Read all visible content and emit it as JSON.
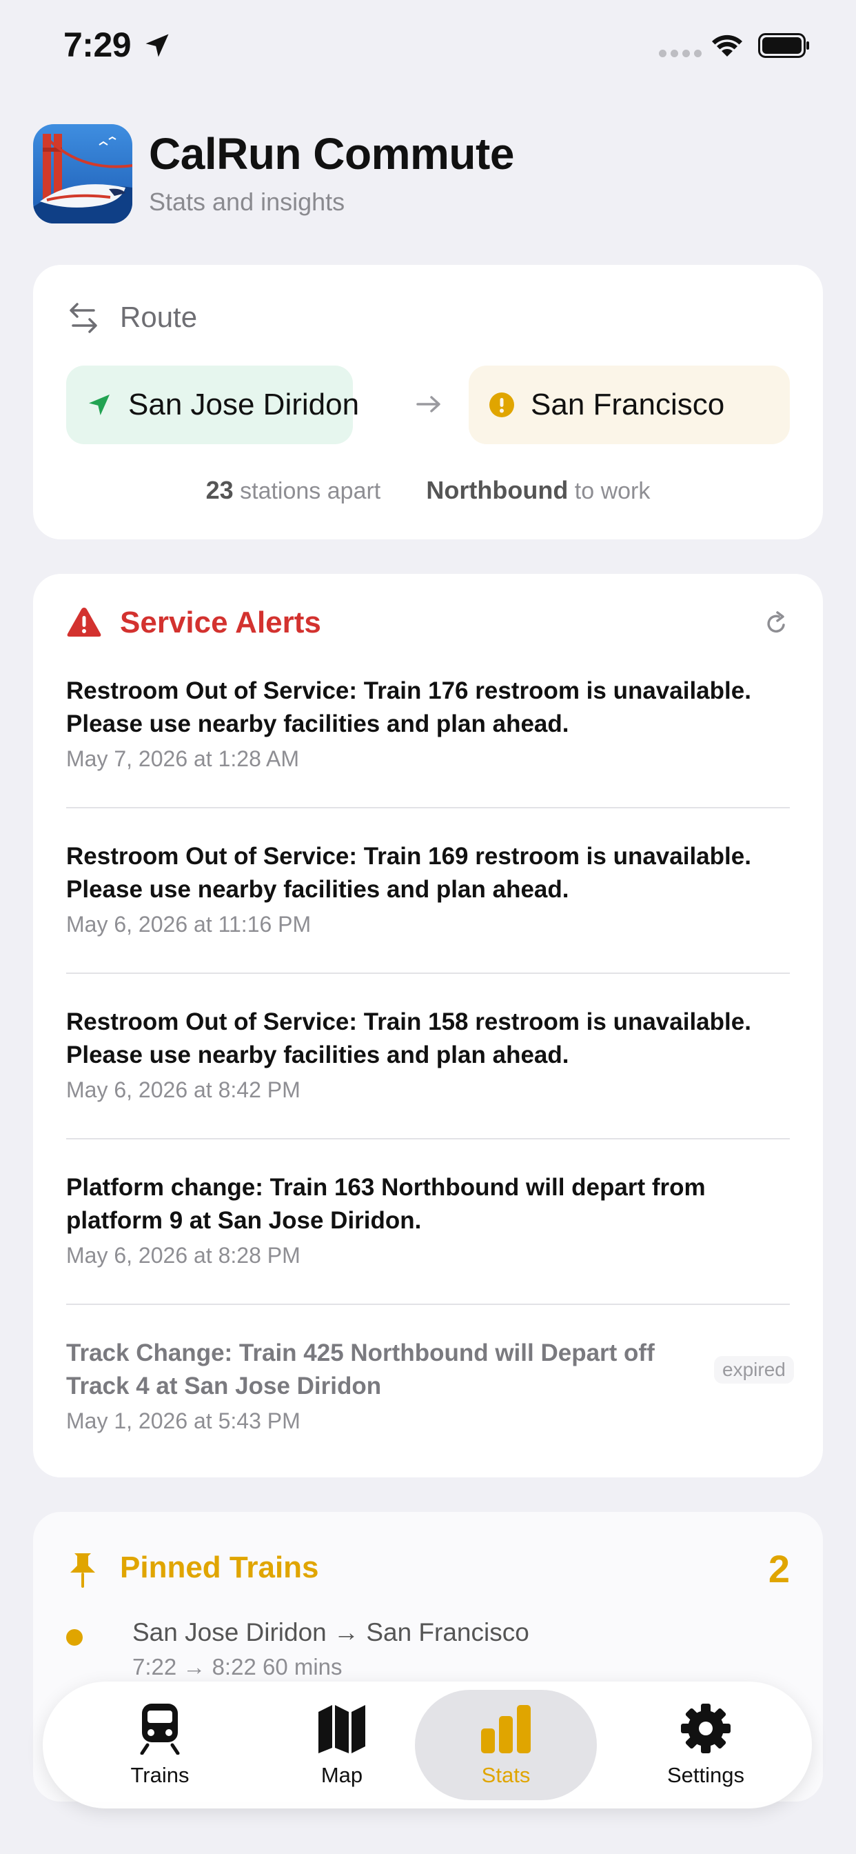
{
  "status_bar": {
    "time": "7:29"
  },
  "header": {
    "title": "CalRun Commute",
    "subtitle": "Stats and insights"
  },
  "route": {
    "label": "Route",
    "origin": "San Jose Diridon",
    "destination": "San Francisco",
    "stations_count": "23",
    "stations_suffix": "stations apart",
    "direction": "Northbound",
    "direction_suffix": "to work"
  },
  "alerts": {
    "title": "Service Alerts",
    "items": [
      {
        "text": "Restroom Out of Service: Train 176 restroom is unavailable. Please use nearby facilities and plan ahead.",
        "date": "May 7, 2026 at 1:28 AM"
      },
      {
        "text": "Restroom Out of Service: Train 169 restroom is unavailable. Please use nearby facilities and plan ahead.",
        "date": "May 6, 2026 at 11:16 PM"
      },
      {
        "text": "Restroom Out of Service: Train 158 restroom is unavailable. Please use nearby facilities and plan ahead.",
        "date": "May 6, 2026 at 8:42 PM"
      },
      {
        "text": "Platform change: Train 163 Northbound will depart from platform 9 at San Jose Diridon.",
        "date": "May 6, 2026 at 8:28 PM"
      },
      {
        "text": "Track Change: Train 425 Northbound will Depart off Track 4 at San Jose Diridon",
        "date": "May 1, 2026 at 5:43 PM",
        "badge": "expired"
      }
    ]
  },
  "pinned": {
    "title": "Pinned Trains",
    "count": "2",
    "items": [
      {
        "route": "San Jose Diridon → San Francisco",
        "times": "7:22 → 8:22  60 mins"
      }
    ]
  },
  "tabs": [
    {
      "label": "Trains",
      "icon": "train-icon"
    },
    {
      "label": "Map",
      "icon": "map-icon"
    },
    {
      "label": "Stats",
      "icon": "stats-icon",
      "active": true
    },
    {
      "label": "Settings",
      "icon": "gear-icon"
    }
  ],
  "colors": {
    "accent": "#e0a500",
    "alert": "#d3322f",
    "origin_bg": "#e6f6ee",
    "destination_bg": "#fbf5e8",
    "origin_icon": "#22a352"
  }
}
